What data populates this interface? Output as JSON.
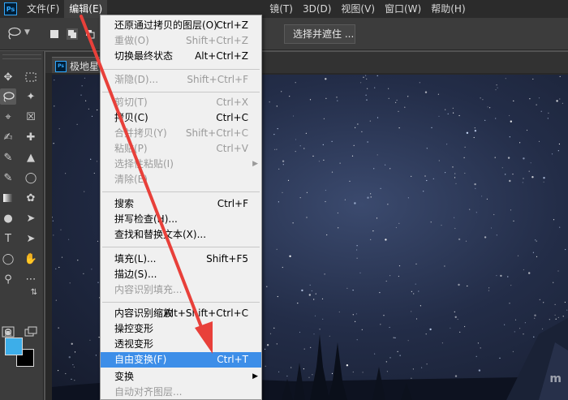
{
  "menubar": {
    "app_logo": "Ps",
    "items": [
      {
        "label": "文件(F)"
      },
      {
        "label": "编辑(E)"
      },
      {
        "label": "镜(T)"
      },
      {
        "label": "3D(D)"
      },
      {
        "label": "视图(V)"
      },
      {
        "label": "窗口(W)"
      },
      {
        "label": "帮助(H)"
      }
    ]
  },
  "options_bar": {
    "select_and_mask_label": "选择并遮住 ..."
  },
  "document": {
    "tab_logo": "Ps",
    "tab_title": "极地星",
    "watermark": "m"
  },
  "edit_menu": {
    "items": [
      {
        "label": "还原通过拷贝的图层(O)",
        "shortcut": "Ctrl+Z",
        "enabled": true
      },
      {
        "label": "重做(O)",
        "shortcut": "Shift+Ctrl+Z",
        "enabled": false
      },
      {
        "label": "切换最终状态",
        "shortcut": "Alt+Ctrl+Z",
        "enabled": true
      },
      {
        "label": "渐隐(D)...",
        "shortcut": "Shift+Ctrl+F",
        "enabled": false
      },
      {
        "label": "剪切(T)",
        "shortcut": "Ctrl+X",
        "enabled": false
      },
      {
        "label": "拷贝(C)",
        "shortcut": "Ctrl+C",
        "enabled": true
      },
      {
        "label": "合并拷贝(Y)",
        "shortcut": "Shift+Ctrl+C",
        "enabled": false
      },
      {
        "label": "粘贴(P)",
        "shortcut": "Ctrl+V",
        "enabled": false
      },
      {
        "label": "选择性粘贴(I)",
        "shortcut": "",
        "enabled": false,
        "submenu": true
      },
      {
        "label": "清除(E)",
        "shortcut": "",
        "enabled": false
      },
      {
        "label": "搜索",
        "shortcut": "Ctrl+F",
        "enabled": true
      },
      {
        "label": "拼写检查(H)...",
        "shortcut": "",
        "enabled": true
      },
      {
        "label": "查找和替换文本(X)...",
        "shortcut": "",
        "enabled": true
      },
      {
        "label": "填充(L)...",
        "shortcut": "Shift+F5",
        "enabled": true
      },
      {
        "label": "描边(S)...",
        "shortcut": "",
        "enabled": true
      },
      {
        "label": "内容识别填充...",
        "shortcut": "",
        "enabled": false
      },
      {
        "label": "内容识别缩放",
        "shortcut": "Alt+Shift+Ctrl+C",
        "enabled": true
      },
      {
        "label": "操控变形",
        "shortcut": "",
        "enabled": true
      },
      {
        "label": "透视变形",
        "shortcut": "",
        "enabled": true
      },
      {
        "label": "自由变换(F)",
        "shortcut": "Ctrl+T",
        "enabled": true,
        "highlighted": true
      },
      {
        "label": "变换",
        "shortcut": "",
        "enabled": true,
        "submenu": true
      },
      {
        "label": "自动对齐图层...",
        "shortcut": "",
        "enabled": false
      }
    ],
    "submenu_glyph": "▶"
  },
  "colors": {
    "foreground": "#3daee9",
    "background": "#000000",
    "highlight": "#3d8ee8",
    "annotation_arrow": "#e8403a"
  }
}
